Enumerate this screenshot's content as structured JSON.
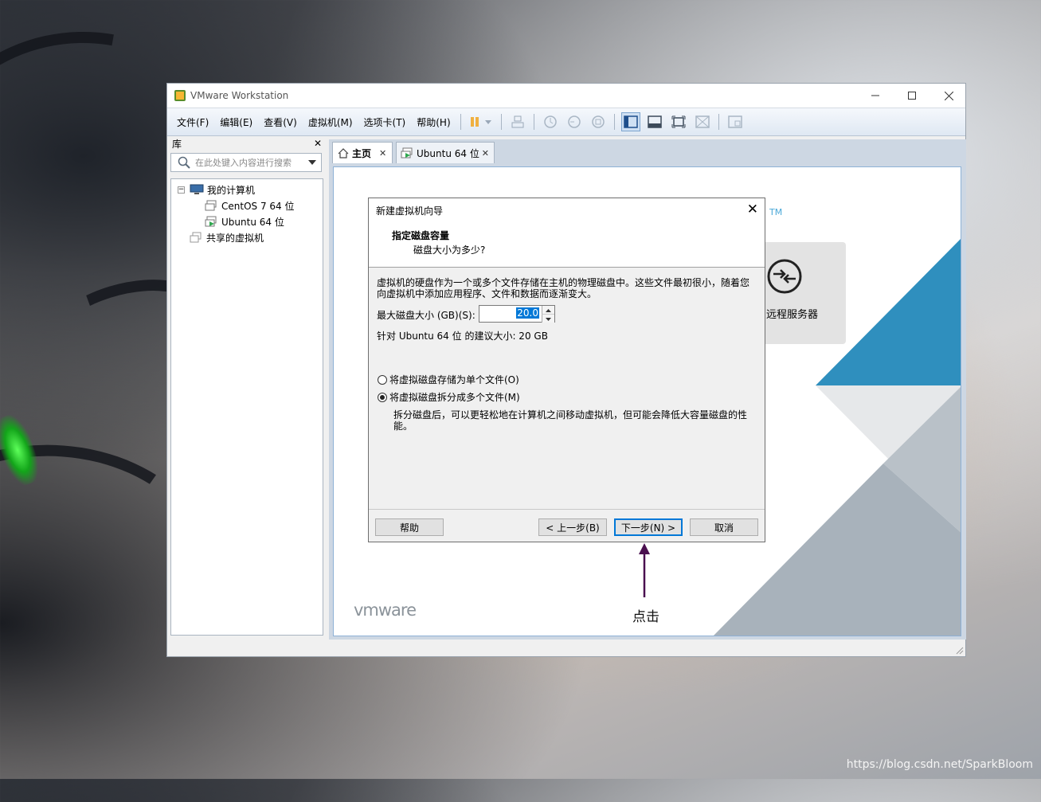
{
  "window": {
    "title": "VMware Workstation"
  },
  "menu": [
    "文件(F)",
    "编辑(E)",
    "查看(V)",
    "虚拟机(M)",
    "选项卡(T)",
    "帮助(H)"
  ],
  "library": {
    "title": "库",
    "close": "✕",
    "search_placeholder": "在此处键入内容进行搜索",
    "my_computer": "我的计算机",
    "vms": [
      "CentOS 7 64 位",
      "Ubuntu 64 位"
    ],
    "shared": "共享的虚拟机"
  },
  "tabs": [
    {
      "label": "主页",
      "close": "✕"
    },
    {
      "label": "Ubuntu 64 位",
      "close": "✕"
    }
  ],
  "home": {
    "tm": "TM",
    "remote_server": "远程服务器",
    "logo": "vmware"
  },
  "dialog": {
    "title": "新建虚拟机向导",
    "close": "✕",
    "heading": "指定磁盘容量",
    "subheading": "磁盘大小为多少?",
    "description_line1": "虚拟机的硬盘作为一个或多个文件存储在主机的物理磁盘中。这些文件最初很小，随着您",
    "description_line2": "向虚拟机中添加应用程序、文件和数据而逐渐变大。",
    "disk_size_label": "最大磁盘大小 (GB)(S):",
    "disk_size_value": "20.0",
    "recommended": "针对 Ubuntu 64 位 的建议大小: 20 GB",
    "option_single": "将虚拟磁盘存储为单个文件(O)",
    "option_split": "将虚拟磁盘拆分成多个文件(M)",
    "option_split_selected": true,
    "split_desc_line1": "拆分磁盘后，可以更轻松地在计算机之间移动虚拟机，但可能会降低大容量磁盘的性",
    "split_desc_line2": "能。",
    "buttons": {
      "help": "帮助",
      "back": "< 上一步(B)",
      "next": "下一步(N) >",
      "cancel": "取消"
    }
  },
  "annotation": "点击",
  "watermark": "https://blog.csdn.net/SparkBloom",
  "colors": {
    "accent": "#0078d7",
    "vmware_blue": "#1f8fc0",
    "arrow": "#4a0f4f"
  }
}
